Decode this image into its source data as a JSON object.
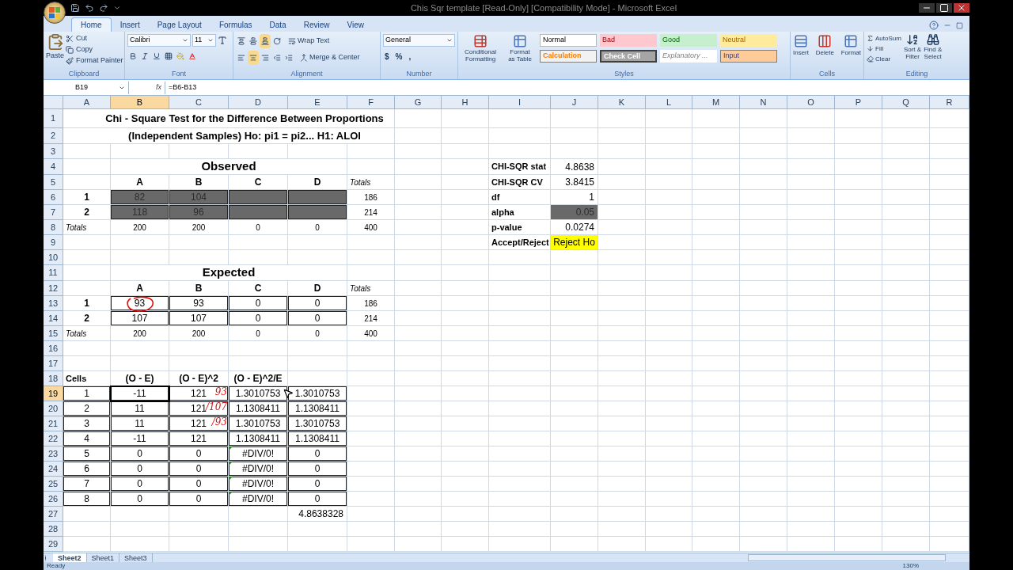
{
  "window": {
    "title": "Chis Sqr template  [Read-Only]  [Compatibility Mode]  -  Microsoft Excel"
  },
  "tabs": [
    {
      "label": "Home",
      "selected": true
    },
    {
      "label": "Insert",
      "selected": false
    },
    {
      "label": "Page Layout",
      "selected": false
    },
    {
      "label": "Formulas",
      "selected": false
    },
    {
      "label": "Data",
      "selected": false
    },
    {
      "label": "Review",
      "selected": false
    },
    {
      "label": "View",
      "selected": false
    }
  ],
  "ribbon": {
    "clipboard": {
      "title": "Clipboard",
      "paste": "Paste",
      "cut": "Cut",
      "copy": "Copy",
      "format_painter": "Format Painter"
    },
    "font": {
      "title": "Font",
      "name": "Calibri",
      "size": "11"
    },
    "alignment": {
      "title": "Alignment",
      "wrap": "Wrap Text",
      "merge": "Merge & Center"
    },
    "number": {
      "title": "Number",
      "format": "General",
      "currency": "$",
      "percent": "%",
      "comma": ","
    },
    "styles": {
      "title": "Styles",
      "conditional": [
        "Conditional",
        "Formatting"
      ],
      "table": [
        "Format",
        "as Table"
      ],
      "cells": [
        {
          "label": "Normal",
          "kind": "normal"
        },
        {
          "label": "Bad",
          "kind": "bad"
        },
        {
          "label": "Good",
          "kind": "good"
        },
        {
          "label": "Neutral",
          "kind": "neutral"
        },
        {
          "label": "Calculation",
          "kind": "calculation"
        },
        {
          "label": "Check Cell",
          "kind": "check"
        },
        {
          "label": "Explanatory ...",
          "kind": "explanatory"
        },
        {
          "label": "Input",
          "kind": "input"
        }
      ]
    },
    "cells": {
      "title": "Cells",
      "insert": "Insert",
      "delete": "Delete",
      "format": "Format"
    },
    "editing": {
      "title": "Editing",
      "autosum": "AutoSum",
      "fill": "Fill",
      "clear": "Clear",
      "sort": [
        "Sort &",
        "Filter"
      ],
      "find": [
        "Find &",
        "Select"
      ]
    }
  },
  "formula_bar": {
    "name_box": "B19",
    "fx": "fx",
    "formula": "=B6-B13"
  },
  "columns": [
    {
      "label": "A",
      "selected": false
    },
    {
      "label": "B",
      "selected": true
    },
    {
      "label": "C",
      "selected": false
    },
    {
      "label": "D",
      "selected": false
    },
    {
      "label": "E",
      "selected": false
    },
    {
      "label": "F",
      "selected": false
    },
    {
      "label": "G",
      "selected": false
    },
    {
      "label": "H",
      "selected": false
    },
    {
      "label": "I",
      "selected": false
    },
    {
      "label": "J",
      "selected": false
    },
    {
      "label": "K",
      "selected": false
    },
    {
      "label": "L",
      "selected": false
    },
    {
      "label": "M",
      "selected": false
    },
    {
      "label": "N",
      "selected": false
    },
    {
      "label": "O",
      "selected": false
    },
    {
      "label": "P",
      "selected": false
    },
    {
      "label": "Q",
      "selected": false
    },
    {
      "label": "R",
      "selected": false
    }
  ],
  "rows": [
    {
      "number": "1",
      "selected": false,
      "cells": [
        {
          "kind": "heading",
          "text": "Chi - Square Test for the Difference Between Proportions",
          "boxed": false
        }
      ]
    },
    {
      "number": "2",
      "selected": false,
      "cells": [
        {
          "kind": "heading",
          "text": "(Independent Samples)  Ho: pi1 = pi2...  H1: ALOI",
          "boxed": false
        }
      ]
    },
    {
      "number": "3",
      "selected": false
    },
    {
      "number": "4",
      "selected": false,
      "cells": [
        {
          "kind": "blank",
          "boxed": false
        },
        {
          "kind": "heading-large",
          "text": "Observed",
          "boxed": false
        },
        {
          "kind": "blank",
          "boxed": false
        },
        {
          "kind": "blank",
          "boxed": false
        },
        {
          "kind": "blank",
          "boxed": false
        },
        {
          "kind": "label",
          "text": "CHI-SQR stat",
          "boxed": false
        },
        {
          "kind": "value",
          "text": "4.8638",
          "boxed": false
        }
      ]
    },
    {
      "number": "5",
      "selected": false,
      "cells": [
        {
          "kind": "blank",
          "boxed": false
        },
        {
          "kind": "col-head",
          "text": "A",
          "boxed": false
        },
        {
          "kind": "col-head",
          "text": "B",
          "boxed": false
        },
        {
          "kind": "col-head",
          "text": "C",
          "boxed": false
        },
        {
          "kind": "col-head",
          "text": "D",
          "boxed": false
        },
        {
          "kind": "note",
          "text": "Totals",
          "boxed": false
        },
        {
          "kind": "blank",
          "boxed": false
        },
        {
          "kind": "blank",
          "boxed": false
        },
        {
          "kind": "label",
          "text": "CHI-SQR CV",
          "boxed": false
        },
        {
          "kind": "value",
          "text": "3.8415",
          "boxed": false
        }
      ]
    },
    {
      "number": "6",
      "selected": false,
      "cells": [
        {
          "kind": "row-head",
          "text": "1",
          "boxed": false
        },
        {
          "kind": "input",
          "text": "82",
          "boxed": true
        },
        {
          "kind": "input",
          "text": "104",
          "boxed": true
        },
        {
          "kind": "input",
          "boxed": true
        },
        {
          "kind": "input",
          "boxed": true
        },
        {
          "kind": "small",
          "text": "186",
          "boxed": false
        },
        {
          "kind": "blank",
          "boxed": false
        },
        {
          "kind": "blank",
          "boxed": false
        },
        {
          "kind": "label",
          "text": "df",
          "boxed": false
        },
        {
          "kind": "value",
          "text": "1",
          "boxed": false
        }
      ]
    },
    {
      "number": "7",
      "selected": false,
      "cells": [
        {
          "kind": "row-head",
          "text": "2",
          "boxed": false
        },
        {
          "kind": "input",
          "text": "118",
          "boxed": true
        },
        {
          "kind": "input",
          "text": "96",
          "boxed": true
        },
        {
          "kind": "input",
          "boxed": true
        },
        {
          "kind": "input",
          "boxed": true
        },
        {
          "kind": "small",
          "text": "214",
          "boxed": false
        },
        {
          "kind": "blank",
          "boxed": false
        },
        {
          "kind": "blank",
          "boxed": false
        },
        {
          "kind": "label",
          "text": "alpha",
          "boxed": false
        },
        {
          "kind": "input-value",
          "text": "0.05",
          "boxed": false
        }
      ]
    },
    {
      "number": "8",
      "selected": false,
      "cells": [
        {
          "kind": "note",
          "text": "Totals",
          "boxed": false
        },
        {
          "kind": "small",
          "text": "200",
          "boxed": false
        },
        {
          "kind": "small",
          "text": "200",
          "boxed": false
        },
        {
          "kind": "small",
          "text": "0",
          "boxed": false
        },
        {
          "kind": "small",
          "text": "0",
          "boxed": false
        },
        {
          "kind": "small",
          "text": "400",
          "boxed": false
        },
        {
          "kind": "blank",
          "boxed": false
        },
        {
          "kind": "blank",
          "boxed": false
        },
        {
          "kind": "label",
          "text": "p-value",
          "boxed": false
        },
        {
          "kind": "value",
          "text": "0.0274",
          "boxed": false
        }
      ]
    },
    {
      "number": "9",
      "selected": false,
      "cells": [
        {
          "kind": "blank",
          "boxed": false
        },
        {
          "kind": "blank",
          "boxed": false
        },
        {
          "kind": "blank",
          "boxed": false
        },
        {
          "kind": "blank",
          "boxed": false
        },
        {
          "kind": "blank",
          "boxed": false
        },
        {
          "kind": "blank",
          "boxed": false
        },
        {
          "kind": "blank",
          "boxed": false
        },
        {
          "kind": "blank",
          "boxed": false
        },
        {
          "kind": "label",
          "text": "Accept/Reject",
          "boxed": false
        },
        {
          "kind": "highlight",
          "text": "Reject Ho",
          "boxed": false
        }
      ]
    },
    {
      "number": "10",
      "selected": false
    },
    {
      "number": "11",
      "selected": false,
      "cells": [
        {
          "kind": "blank",
          "boxed": false
        },
        {
          "kind": "heading-large",
          "text": "Expected",
          "boxed": false
        }
      ]
    },
    {
      "number": "12",
      "selected": false,
      "cells": [
        {
          "kind": "blank",
          "boxed": false
        },
        {
          "kind": "col-head",
          "text": "A",
          "boxed": false
        },
        {
          "kind": "col-head",
          "text": "B",
          "boxed": false
        },
        {
          "kind": "col-head",
          "text": "C",
          "boxed": false
        },
        {
          "kind": "col-head",
          "text": "D",
          "boxed": false
        },
        {
          "kind": "note",
          "text": "Totals",
          "boxed": false
        }
      ]
    },
    {
      "number": "13",
      "selected": false,
      "cells": [
        {
          "kind": "row-head",
          "text": "1",
          "boxed": false
        },
        {
          "kind": "number",
          "text": "93",
          "boxed": true
        },
        {
          "kind": "number",
          "text": "93",
          "boxed": true
        },
        {
          "kind": "number",
          "text": "0",
          "boxed": true
        },
        {
          "kind": "number",
          "text": "0",
          "boxed": true
        },
        {
          "kind": "small",
          "text": "186",
          "boxed": false
        }
      ]
    },
    {
      "number": "14",
      "selected": false,
      "cells": [
        {
          "kind": "row-head",
          "text": "2",
          "boxed": false
        },
        {
          "kind": "number",
          "text": "107",
          "boxed": true
        },
        {
          "kind": "number",
          "text": "107",
          "boxed": true
        },
        {
          "kind": "number",
          "text": "0",
          "boxed": true
        },
        {
          "kind": "number",
          "text": "0",
          "boxed": true
        },
        {
          "kind": "small",
          "text": "214",
          "boxed": false
        }
      ]
    },
    {
      "number": "15",
      "selected": false,
      "cells": [
        {
          "kind": "note",
          "text": "Totals",
          "boxed": false
        },
        {
          "kind": "small",
          "text": "200",
          "boxed": false
        },
        {
          "kind": "small",
          "text": "200",
          "boxed": false
        },
        {
          "kind": "small",
          "text": "0",
          "boxed": false
        },
        {
          "kind": "small",
          "text": "0",
          "boxed": false
        },
        {
          "kind": "small",
          "text": "400",
          "boxed": false
        }
      ]
    },
    {
      "number": "16",
      "selected": false
    },
    {
      "number": "17",
      "selected": false
    },
    {
      "number": "18",
      "selected": false,
      "cells": [
        {
          "kind": "label",
          "text": "Cells",
          "boxed": false
        },
        {
          "kind": "col-head",
          "text": "(O - E)",
          "boxed": false
        },
        {
          "kind": "col-head",
          "text": "(O - E)^2",
          "boxed": false
        },
        {
          "kind": "col-head",
          "text": "(O - E)^2/E",
          "boxed": false
        }
      ]
    },
    {
      "number": "19",
      "selected": true,
      "cells": [
        {
          "kind": "number",
          "text": "1",
          "boxed": true
        },
        {
          "kind": "number",
          "text": "-11",
          "boxed": true
        },
        {
          "kind": "number",
          "text": "121",
          "boxed": true,
          "annotation": "93"
        },
        {
          "kind": "number",
          "text": "1.3010753",
          "boxed": true
        },
        {
          "kind": "number",
          "text": "1.3010753",
          "boxed": true
        }
      ]
    },
    {
      "number": "20",
      "selected": false,
      "cells": [
        {
          "kind": "number",
          "text": "2",
          "boxed": true
        },
        {
          "kind": "number",
          "text": "11",
          "boxed": true
        },
        {
          "kind": "number",
          "text": "121",
          "boxed": true,
          "annotation": "/107"
        },
        {
          "kind": "number",
          "text": "1.1308411",
          "boxed": true
        },
        {
          "kind": "number",
          "text": "1.1308411",
          "boxed": true
        }
      ]
    },
    {
      "number": "21",
      "selected": false,
      "cells": [
        {
          "kind": "number",
          "text": "3",
          "boxed": true
        },
        {
          "kind": "number",
          "text": "11",
          "boxed": true
        },
        {
          "kind": "number",
          "text": "121",
          "boxed": true,
          "annotation": "/93"
        },
        {
          "kind": "number",
          "text": "1.3010753",
          "boxed": true
        },
        {
          "kind": "number",
          "text": "1.3010753",
          "boxed": true
        }
      ]
    },
    {
      "number": "22",
      "selected": false,
      "cells": [
        {
          "kind": "number",
          "text": "4",
          "boxed": true
        },
        {
          "kind": "number",
          "text": "-11",
          "boxed": true
        },
        {
          "kind": "number",
          "text": "121",
          "boxed": true
        },
        {
          "kind": "number",
          "text": "1.1308411",
          "boxed": true
        },
        {
          "kind": "number",
          "text": "1.1308411",
          "boxed": true
        }
      ]
    },
    {
      "number": "23",
      "selected": false,
      "cells": [
        {
          "kind": "number",
          "text": "5",
          "boxed": true
        },
        {
          "kind": "number",
          "text": "0",
          "boxed": true
        },
        {
          "kind": "number",
          "text": "0",
          "boxed": true
        },
        {
          "kind": "error",
          "text": "#DIV/0!",
          "boxed": true
        },
        {
          "kind": "number",
          "text": "0",
          "boxed": true
        }
      ]
    },
    {
      "number": "24",
      "selected": false,
      "cells": [
        {
          "kind": "number",
          "text": "6",
          "boxed": true
        },
        {
          "kind": "number",
          "text": "0",
          "boxed": true
        },
        {
          "kind": "number",
          "text": "0",
          "boxed": true
        },
        {
          "kind": "error",
          "text": "#DIV/0!",
          "boxed": true
        },
        {
          "kind": "number",
          "text": "0",
          "boxed": true
        }
      ]
    },
    {
      "number": "25",
      "selected": false,
      "cells": [
        {
          "kind": "number",
          "text": "7",
          "boxed": true
        },
        {
          "kind": "number",
          "text": "0",
          "boxed": true
        },
        {
          "kind": "number",
          "text": "0",
          "boxed": true
        },
        {
          "kind": "error",
          "text": "#DIV/0!",
          "boxed": true
        },
        {
          "kind": "number",
          "text": "0",
          "boxed": true
        }
      ]
    },
    {
      "number": "26",
      "selected": false,
      "cells": [
        {
          "kind": "number",
          "text": "8",
          "boxed": true
        },
        {
          "kind": "number",
          "text": "0",
          "boxed": true
        },
        {
          "kind": "number",
          "text": "0",
          "boxed": true
        },
        {
          "kind": "error",
          "text": "#DIV/0!",
          "boxed": true
        },
        {
          "kind": "number",
          "text": "0",
          "boxed": true
        }
      ]
    },
    {
      "number": "27",
      "selected": false,
      "cells": [
        {
          "kind": "blank",
          "boxed": false
        },
        {
          "kind": "blank",
          "boxed": false
        },
        {
          "kind": "blank",
          "boxed": false
        },
        {
          "kind": "blank",
          "boxed": false
        },
        {
          "kind": "value",
          "text": "4.8638328",
          "boxed": false
        }
      ]
    },
    {
      "number": "28",
      "selected": false
    },
    {
      "number": "29",
      "selected": false
    }
  ],
  "sheet_tabs": [
    {
      "label": "Sheet2",
      "selected": true
    },
    {
      "label": "Sheet1",
      "selected": false
    },
    {
      "label": "Sheet3",
      "selected": false
    }
  ],
  "status_bar": {
    "status": "Ready",
    "zoom": "130%"
  }
}
